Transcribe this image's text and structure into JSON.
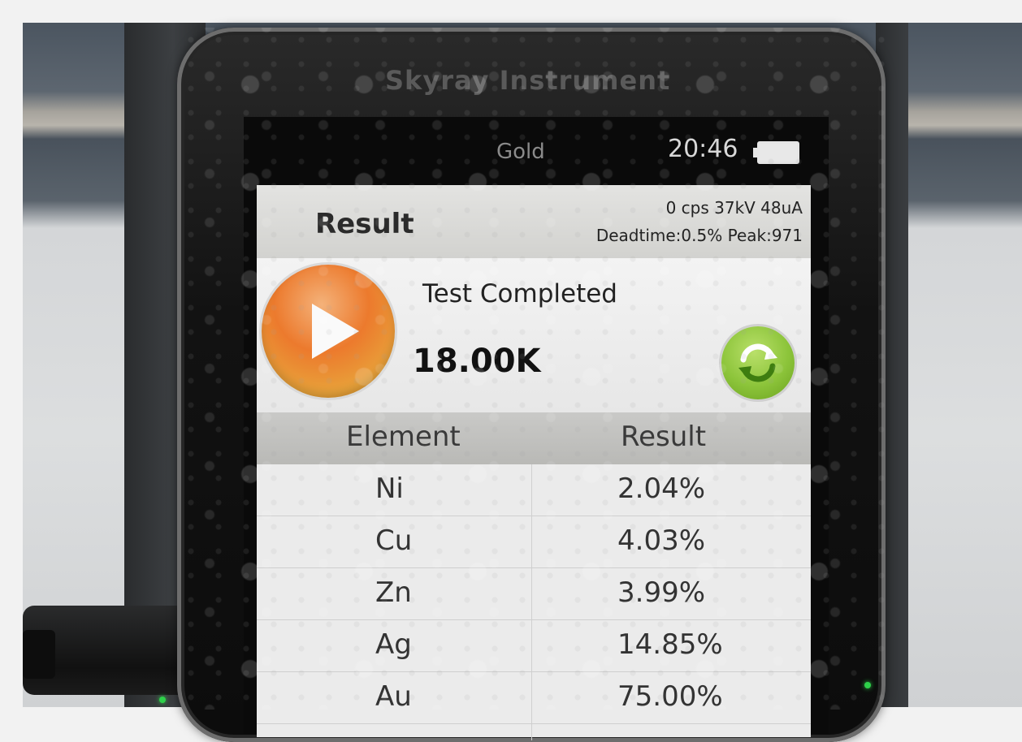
{
  "device": {
    "brand": "Skyray Instrument"
  },
  "status_bar": {
    "carrier": "Gold",
    "time": "20:46",
    "battery_icon": "battery-full-icon"
  },
  "header": {
    "title": "Result",
    "stats_line1": "0 cps 37kV 48uA",
    "stats_line2": "Deadtime:0.5% Peak:971"
  },
  "test": {
    "status": "Test Completed",
    "count": "18.00K",
    "play_icon": "play-icon",
    "refresh_icon": "refresh-icon"
  },
  "table": {
    "columns": [
      "Element",
      "Result"
    ],
    "rows": [
      {
        "element": "Ni",
        "result": "2.04%"
      },
      {
        "element": "Cu",
        "result": "4.03%"
      },
      {
        "element": "Zn",
        "result": "3.99%"
      },
      {
        "element": "Ag",
        "result": "14.85%"
      },
      {
        "element": "Au",
        "result": "75.00%"
      }
    ]
  },
  "colors": {
    "play_button": "#ec7a2d",
    "refresh_button": "#8cc43a",
    "status_led": "#2ed14a"
  }
}
